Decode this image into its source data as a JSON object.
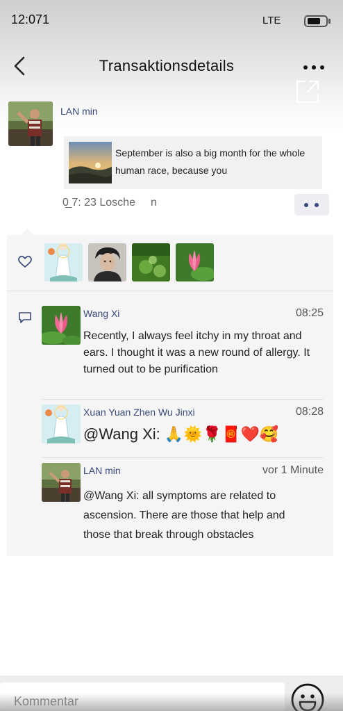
{
  "status_bar": {
    "time": "12:071",
    "network": "LTE"
  },
  "header": {
    "title": "Transaktionsdetails"
  },
  "post": {
    "author": "LAN min",
    "link_text": "September is also a big month for the whole human race, because you",
    "meta_time": "0̲ 7: 23 Losche",
    "meta_extra": "n"
  },
  "likes": {
    "avatars": [
      "guanyin-avatar",
      "portrait-avatar",
      "green-field-avatar",
      "lotus-avatar"
    ]
  },
  "comments": [
    {
      "name": "Wang Xi",
      "time": "08:25",
      "text": "Recently, I always feel itchy in my throat and ears. I thought it was a new round of allergy. It turned out to be purification"
    },
    {
      "name": "Xuan Yuan Zhen Wu Jinxi",
      "time": "08:28",
      "text": "@Wang Xi: 🙏🌞🌹🧧❤️🥰"
    },
    {
      "name": "LAN min",
      "time": "vor 1 Minute",
      "text": "@Wang Xi: all symptoms are related to ascension. There are those that help and those that break through obstacles"
    }
  ],
  "input": {
    "placeholder": "Kommentar"
  },
  "colors": {
    "name_blue": "#3a4a7a",
    "panel": "#f5f5f5"
  }
}
